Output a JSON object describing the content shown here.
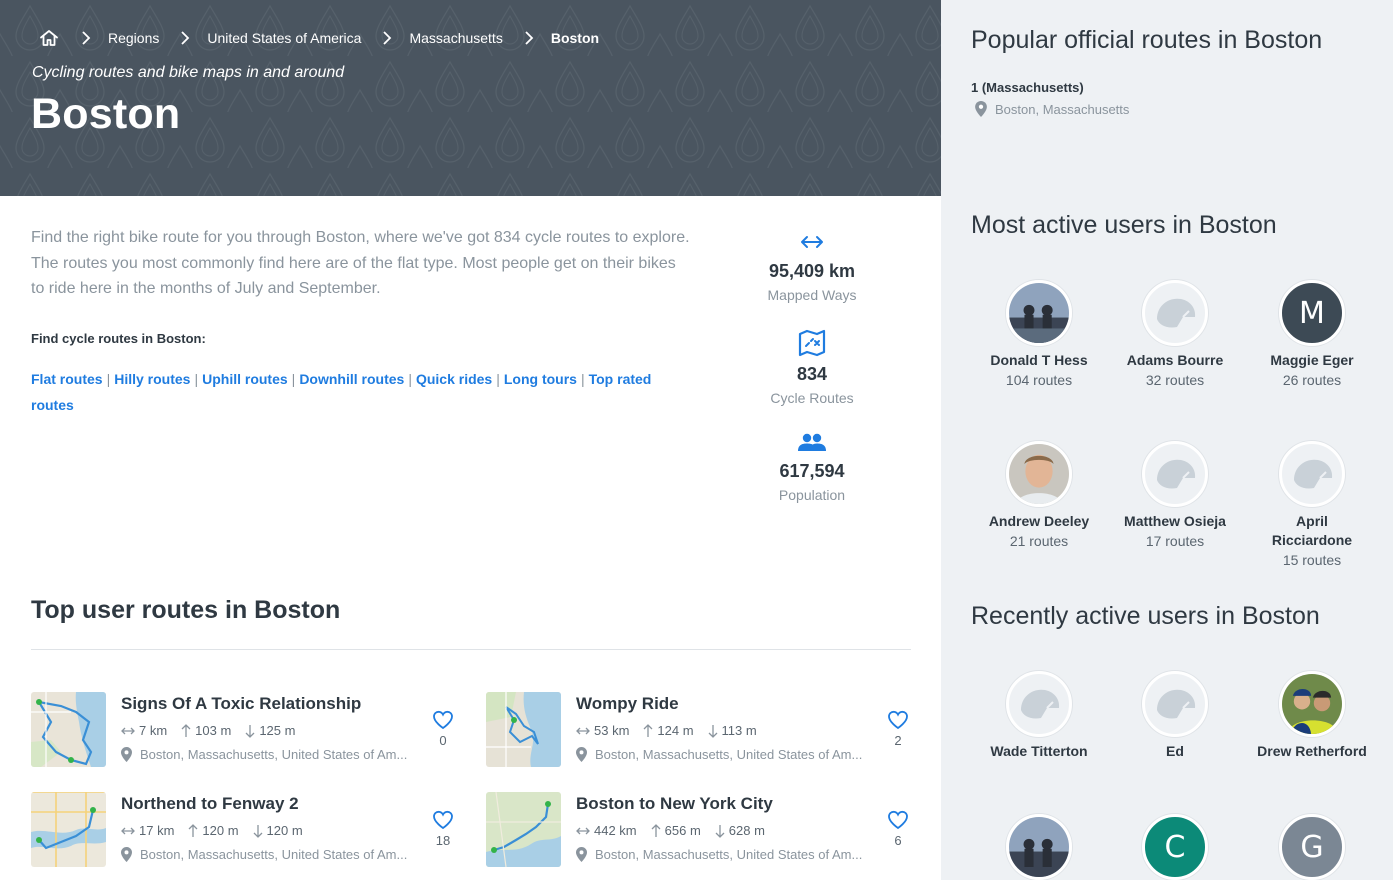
{
  "breadcrumb": {
    "items": [
      "Regions",
      "United States of America",
      "Massachusetts",
      "Boston"
    ]
  },
  "hero": {
    "subtitle": "Cycling routes and bike maps in and around",
    "title": "Boston"
  },
  "intro": {
    "text": "Find the right bike route for you through Boston, where we've got 834 cycle routes to explore. The routes you most commonly find here are of the flat type. Most people get on their bikes to ride here in the months of July and September.",
    "find_heading": "Find cycle routes in Boston:",
    "links": [
      "Flat routes",
      "Hilly routes",
      "Uphill routes",
      "Downhill routes",
      "Quick rides",
      "Long tours",
      "Top rated routes"
    ]
  },
  "stats": [
    {
      "icon": "arrows-horizontal-icon",
      "value": "95,409 km",
      "label": "Mapped Ways"
    },
    {
      "icon": "map-icon",
      "value": "834",
      "label": "Cycle Routes"
    },
    {
      "icon": "people-icon",
      "value": "617,594",
      "label": "Population"
    }
  ],
  "top_routes": {
    "heading": "Top user routes in Boston",
    "routes": [
      {
        "title": "Signs Of A Toxic Relationship",
        "distance": "7 km",
        "up": "103 m",
        "down": "125 m",
        "location": "Boston, Massachusetts, United States of Am...",
        "likes": "0"
      },
      {
        "title": "Wompy Ride",
        "distance": "53 km",
        "up": "124 m",
        "down": "113 m",
        "location": "Boston, Massachusetts, United States of Am...",
        "likes": "2"
      },
      {
        "title": "Northend to Fenway 2",
        "distance": "17 km",
        "up": "120 m",
        "down": "120 m",
        "location": "Boston, Massachusetts, United States of Am...",
        "likes": "18"
      },
      {
        "title": "Boston to New York City",
        "distance": "442 km",
        "up": "656 m",
        "down": "628 m",
        "location": "Boston, Massachusetts, United States of Am...",
        "likes": "6"
      }
    ]
  },
  "sidebar": {
    "popular_heading": "Popular official routes in Boston",
    "popular_route": {
      "name": "1 (Massachusetts)",
      "location": "Boston, Massachusetts"
    },
    "active_heading": "Most active users in Boston",
    "active_users": [
      {
        "name": "Donald T Hess",
        "routes": "104 routes",
        "avatar": "photo"
      },
      {
        "name": "Adams Bourre",
        "routes": "32 routes",
        "avatar": "helmet"
      },
      {
        "name": "Maggie Eger",
        "routes": "26 routes",
        "avatar": "letter",
        "letter": "M",
        "color": "#3d4a55"
      },
      {
        "name": "Andrew Deeley",
        "routes": "21 routes",
        "avatar": "photo"
      },
      {
        "name": "Matthew Osieja",
        "routes": "17 routes",
        "avatar": "helmet"
      },
      {
        "name": "April Ricciardone",
        "routes": "15 routes",
        "avatar": "helmet"
      }
    ],
    "recent_heading": "Recently active users in Boston",
    "recent_users": [
      {
        "name": "Wade Titterton",
        "avatar": "helmet"
      },
      {
        "name": "Ed",
        "avatar": "helmet"
      },
      {
        "name": "Drew Retherford",
        "avatar": "photo"
      },
      {
        "name": "",
        "avatar": "photo"
      },
      {
        "name": "",
        "avatar": "letter",
        "letter": "C",
        "color": "#0c8a78"
      },
      {
        "name": "",
        "avatar": "letter",
        "letter": "G",
        "color": "#7b8794"
      }
    ]
  },
  "colors": {
    "hero_bg": "#4a5560",
    "link": "#1f7ce0",
    "sidebar_bg": "#eef1f4"
  }
}
